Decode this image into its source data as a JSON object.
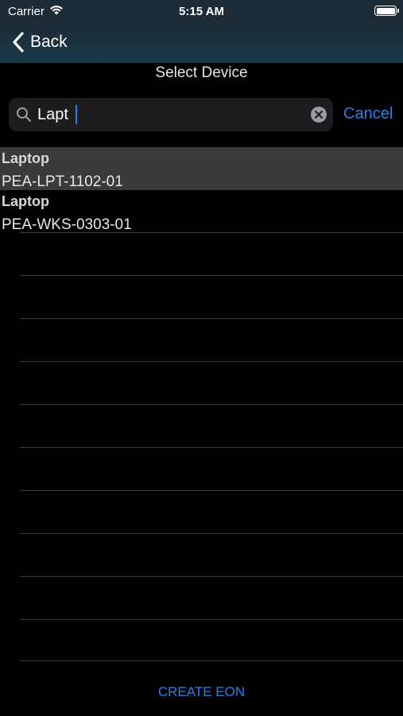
{
  "status_bar": {
    "carrier": "Carrier",
    "time": "5:15 AM"
  },
  "nav": {
    "back_label": "Back",
    "back_icon": "chevron-left-icon"
  },
  "page": {
    "title": "Select Device"
  },
  "search": {
    "value": "Lapt",
    "cancel_label": "Cancel",
    "accent_color": "#2f7fe8"
  },
  "results": [
    {
      "type": "Laptop",
      "name": "PEA-LPT-1102-01",
      "selected": true
    },
    {
      "type": "Laptop",
      "name": "PEA-WKS-0303-01",
      "selected": false
    }
  ],
  "footer": {
    "create_label": "CREATE EON"
  }
}
